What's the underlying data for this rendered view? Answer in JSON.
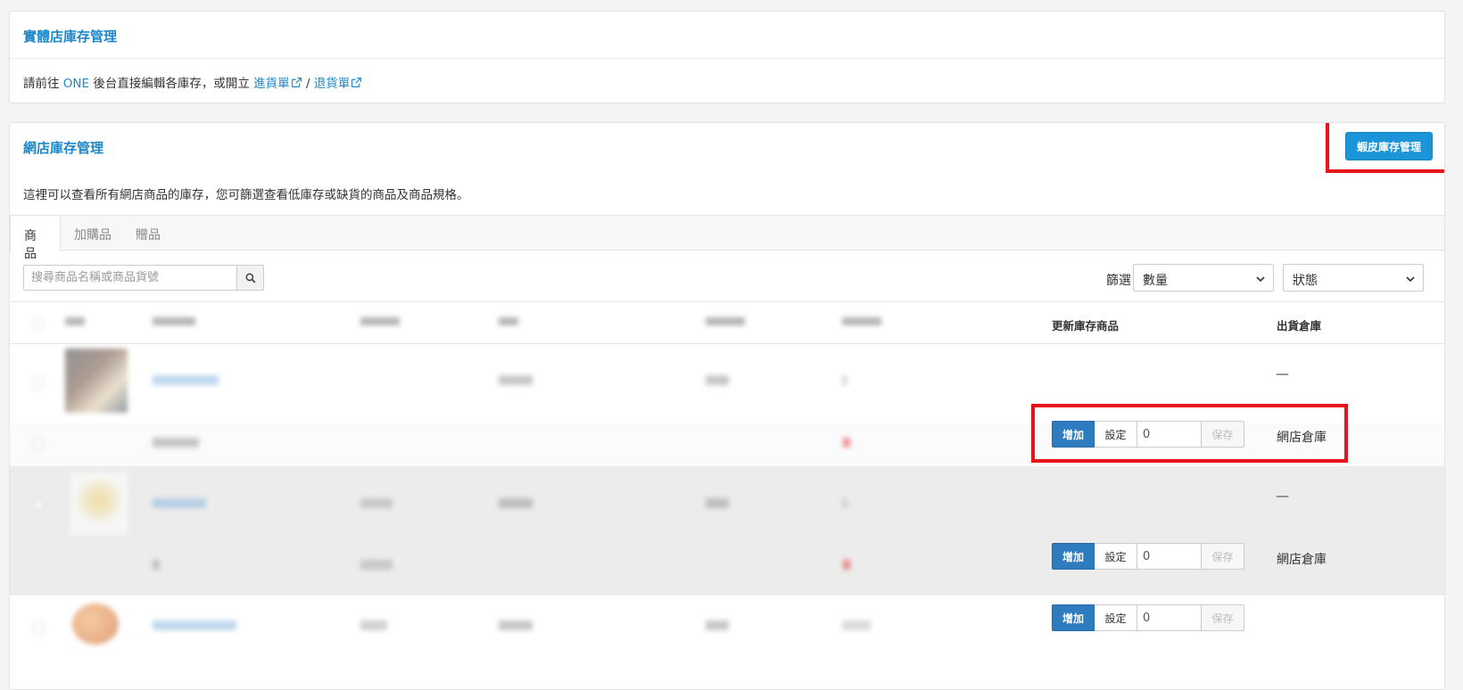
{
  "store_panel": {
    "title": "實體店庫存管理",
    "desc_prefix": "請前往 ",
    "desc_one": "ONE",
    "desc_mid": " 後台直接編輯各庫存，或開立 ",
    "link_inbound": "進貨單",
    "separator": " / ",
    "link_return": "退貨單"
  },
  "online_panel": {
    "title": "網店庫存管理",
    "shopee_button": "蝦皮庫存管理",
    "description": "這裡可以查看所有網店商品的庫存，您可篩選查看低庫存或缺貨的商品及商品規格。",
    "tabs": [
      {
        "label": "商品",
        "active": true
      },
      {
        "label": "加購品",
        "active": false
      },
      {
        "label": "贈品",
        "active": false
      }
    ],
    "search": {
      "placeholder": "搜尋商品名稱或商品貨號",
      "value": ""
    },
    "filter": {
      "label": "篩選",
      "quantity": "數量",
      "status": "狀態"
    },
    "table": {
      "headers": {
        "update_stock": "更新庫存商品",
        "warehouse": "出貨倉庫"
      },
      "controls": {
        "add": "增加",
        "set": "設定",
        "save": "保存",
        "qty": "0"
      },
      "rows": [
        {
          "warehouse": "—"
        },
        {
          "warehouse": "網店倉庫"
        },
        {
          "warehouse": "—"
        },
        {
          "warehouse": "網店倉庫"
        }
      ]
    }
  },
  "colors": {
    "accent": "#1e88c9",
    "primary_button": "#1c95d8",
    "add_button": "#2f7bbf",
    "highlight": "#e8141c"
  }
}
